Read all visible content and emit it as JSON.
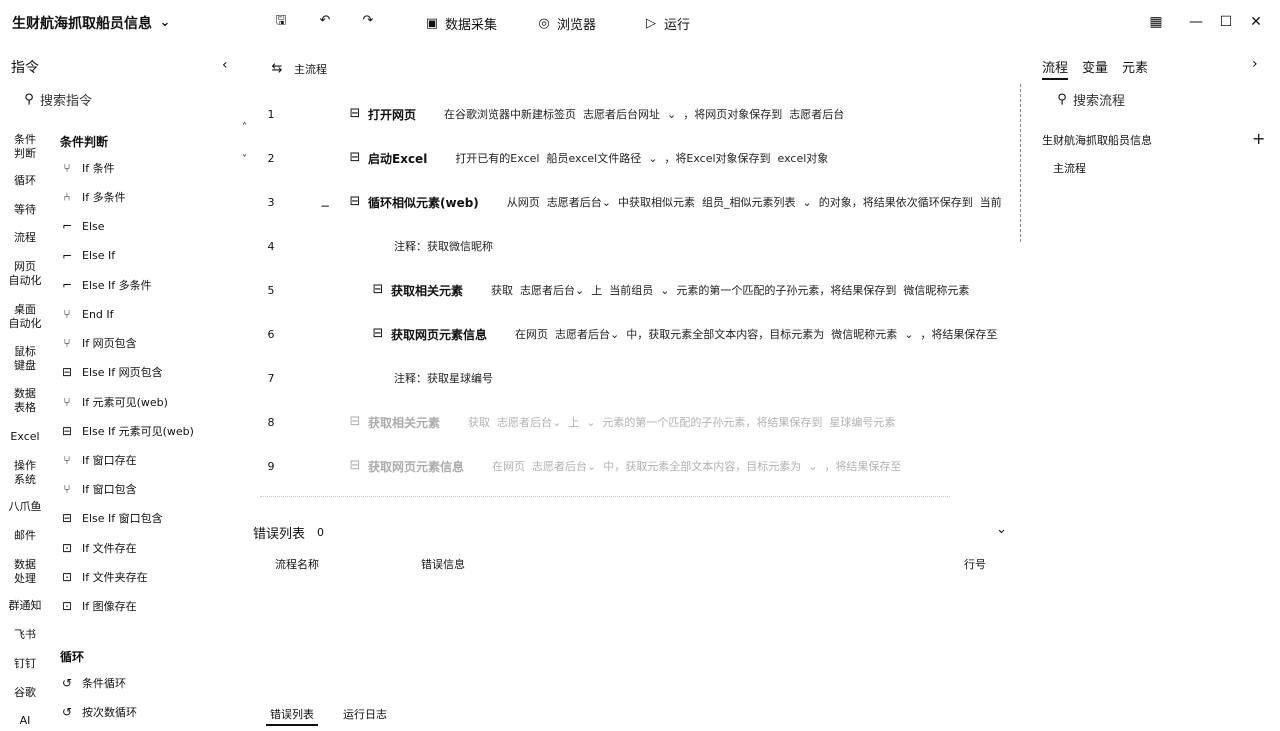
{
  "app": {
    "title": "生财航海抓取船员信息"
  },
  "toolbar": {
    "data_collect": "数据采集",
    "browser": "浏览器",
    "run": "运行"
  },
  "left": {
    "title": "指令",
    "search_placeholder": "搜索指令",
    "categories": [
      "条件\n判断",
      "循环",
      "等待",
      "流程",
      "网页\n自动化",
      "桌面\n自动化",
      "鼠标\n键盘",
      "数据\n表格",
      "Excel",
      "操作\n系统",
      "八爪鱼",
      "邮件",
      "数据\n处理",
      "群通知",
      "飞书",
      "钉钉",
      "谷歌",
      "AI"
    ],
    "section1": "条件判断",
    "commands1": [
      "If 条件",
      "If 多条件",
      "Else",
      "Else If",
      "Else If 多条件",
      "End If",
      "If 网页包含",
      "Else If 网页包含",
      "If 元素可见(web)",
      "Else If 元素可见(web)",
      "If 窗口存在",
      "If 窗口包含",
      "Else If 窗口包含",
      "If 文件存在",
      "If 文件夹存在",
      "If 图像存在"
    ],
    "section2": "循环",
    "commands2": [
      "条件循环",
      "按次数循环"
    ]
  },
  "flow": {
    "name": "主流程",
    "rows": [
      {
        "num": "1",
        "name": "打开网页",
        "desc": "在谷歌浏览器中新建标签页  志愿者后台网址  ⌄  ，将网页对象保存到  志愿者后台"
      },
      {
        "num": "2",
        "name": "启动Excel",
        "desc": "打开已有的Excel  船员excel文件路径  ⌄  ，将Excel对象保存到  excel对象"
      },
      {
        "num": "3",
        "name": "循环相似元素(web)",
        "desc": "从网页  志愿者后台⌄  中获取相似元素  组员_相似元素列表  ⌄  的对象，将结果依次循环保存到  当前"
      },
      {
        "num": "4",
        "name": "",
        "desc": "注释：获取微信昵称"
      },
      {
        "num": "5",
        "name": "获取相关元素",
        "desc": "获取  志愿者后台⌄  上  当前组员  ⌄  元素的第一个匹配的子孙元素，将结果保存到  微信昵称元素"
      },
      {
        "num": "6",
        "name": "获取网页元素信息",
        "desc": "在网页  志愿者后台⌄  中，获取元素全部文本内容，目标元素为  微信昵称元素  ⌄  ，将结果保存至"
      },
      {
        "num": "7",
        "name": "",
        "desc": "注释：获取星球编号"
      },
      {
        "num": "8",
        "name": "获取相关元素",
        "desc": "获取  志愿者后台⌄  上  ⌄  元素的第一个匹配的子孙元素，将结果保存到  星球编号元素"
      },
      {
        "num": "9",
        "name": "获取网页元素信息",
        "desc": "在网页  志愿者后台⌄  中，获取元素全部文本内容，目标元素为  ⌄  ，将结果保存至"
      }
    ]
  },
  "errors": {
    "title": "错误列表",
    "count": "0",
    "col_flow": "流程名称",
    "col_info": "错误信息",
    "col_line": "行号"
  },
  "bottom_tabs": [
    "错误列表",
    "运行日志"
  ],
  "right": {
    "tabs": [
      "流程",
      "变量",
      "元素"
    ],
    "search_placeholder": "搜索流程",
    "project": "生财航海抓取船员信息",
    "flows": [
      "主流程"
    ]
  }
}
